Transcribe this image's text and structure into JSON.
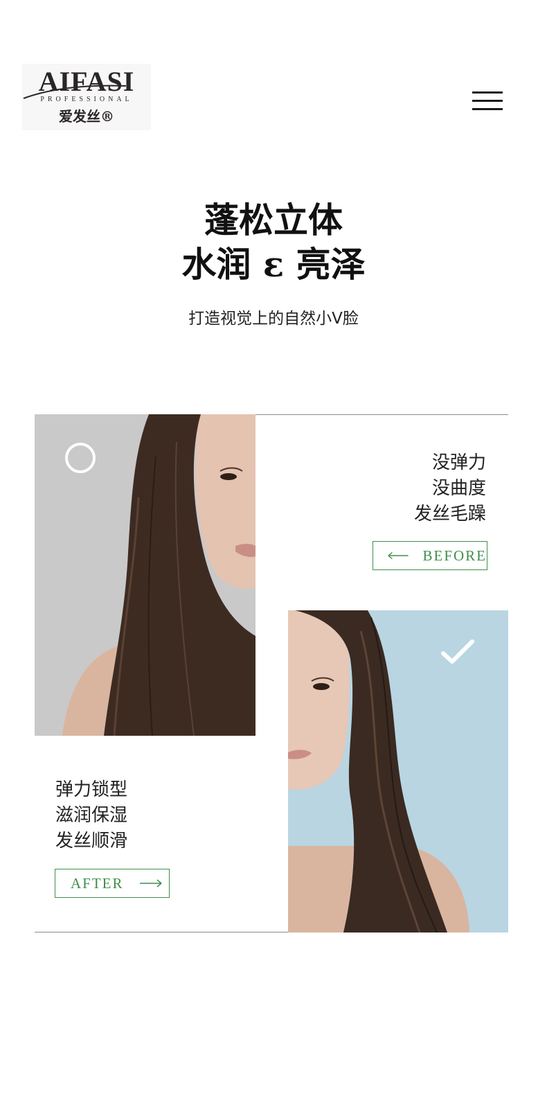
{
  "header": {
    "logo": {
      "brand": "AIFASI",
      "tagline": "PROFESSIONAL",
      "chinese": "爱发丝®"
    },
    "menu_icon": "hamburger-menu-icon"
  },
  "hero": {
    "headline_line1": "蓬松立体",
    "headline_line2": "水润 ε 亮泽",
    "subline": "打造视觉上的自然小V脸"
  },
  "before": {
    "lines": [
      "没弹力",
      "没曲度",
      "发丝毛躁"
    ],
    "button_label": "BEFORE",
    "button_icon": "arrow-left-icon",
    "status_icon": "circle-icon",
    "panel_color": "#c9c9c9"
  },
  "after": {
    "lines": [
      "弹力锁型",
      "滋润保湿",
      "发丝顺滑"
    ],
    "button_label": "AFTER",
    "button_icon": "arrow-right-icon",
    "status_icon": "check-icon",
    "panel_color": "#b9d5e2"
  },
  "colors": {
    "accent_green": "#3f8f4a",
    "text": "#1a1a1a"
  }
}
